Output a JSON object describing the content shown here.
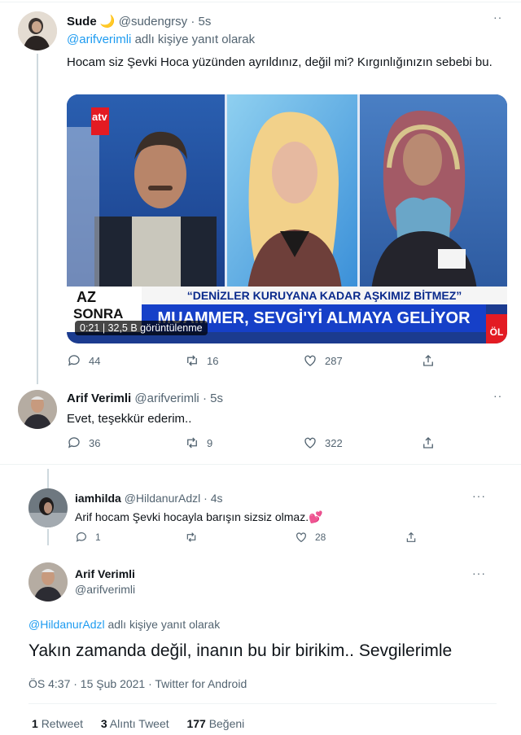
{
  "tweet1": {
    "name": "Sude",
    "moon": "🌙",
    "handle": "@sudengrsy",
    "time": "· 5s",
    "reply_to": "@arifverimli",
    "reply_suffix": " adlı kişiye yanıt olarak",
    "text": "Hocam siz Şevki Hoca yüzünden ayrıldınız, değil mi? Kırgınlığınızın sebebi bu.",
    "media": {
      "channel": "atv",
      "banner_top": "“DENİZLER KURUYANA KADAR AŞKIMIZ BİTMEZ”",
      "banner_main": "MUAMMER, SEVGİ'Yİ ALMAYA GELİYOR",
      "az": "AZ",
      "sonra": "SONRA",
      "corner": "ÖL",
      "duration": "0:21",
      "views": "32,5 B görüntülenme"
    },
    "stats": {
      "replies": "44",
      "retweets": "16",
      "likes": "287"
    }
  },
  "tweet2": {
    "name": "Arif Verimli",
    "handle": "@arifverimli",
    "time": "· 5s",
    "text": "Evet, teşekkür ederim..",
    "stats": {
      "replies": "36",
      "retweets": "9",
      "likes": "322"
    }
  },
  "tweet3": {
    "name": "iamhilda",
    "handle": "@HildanurAdzl",
    "time": "· 4s",
    "text": "Arif hocam Şevki hocayla barışın sizsiz olmaz.",
    "emoji": "💕",
    "stats": {
      "replies": "1",
      "likes": "28"
    }
  },
  "tweet4": {
    "name": "Arif Verimli",
    "handle": "@arifverimli",
    "reply_to": "@HildanurAdzl",
    "reply_suffix": " adlı kişiye yanıt olarak",
    "text": "Yakın zamanda değil, inanın bu bir birikim.. Sevgilerimle",
    "meta": "ÖS 4:37 · 15 Şub 2021 · Twitter for Android",
    "retweets_count": "1",
    "retweets_label": "Retweet",
    "quotes_count": "3",
    "quotes_label": "Alıntı Tweet",
    "likes_count": "177",
    "likes_label": "Beğeni"
  },
  "colors": {
    "link": "#1d9bf0",
    "muted": "#536471",
    "atv_red": "#e31b23",
    "banner_blue": "#0a2a8c"
  }
}
